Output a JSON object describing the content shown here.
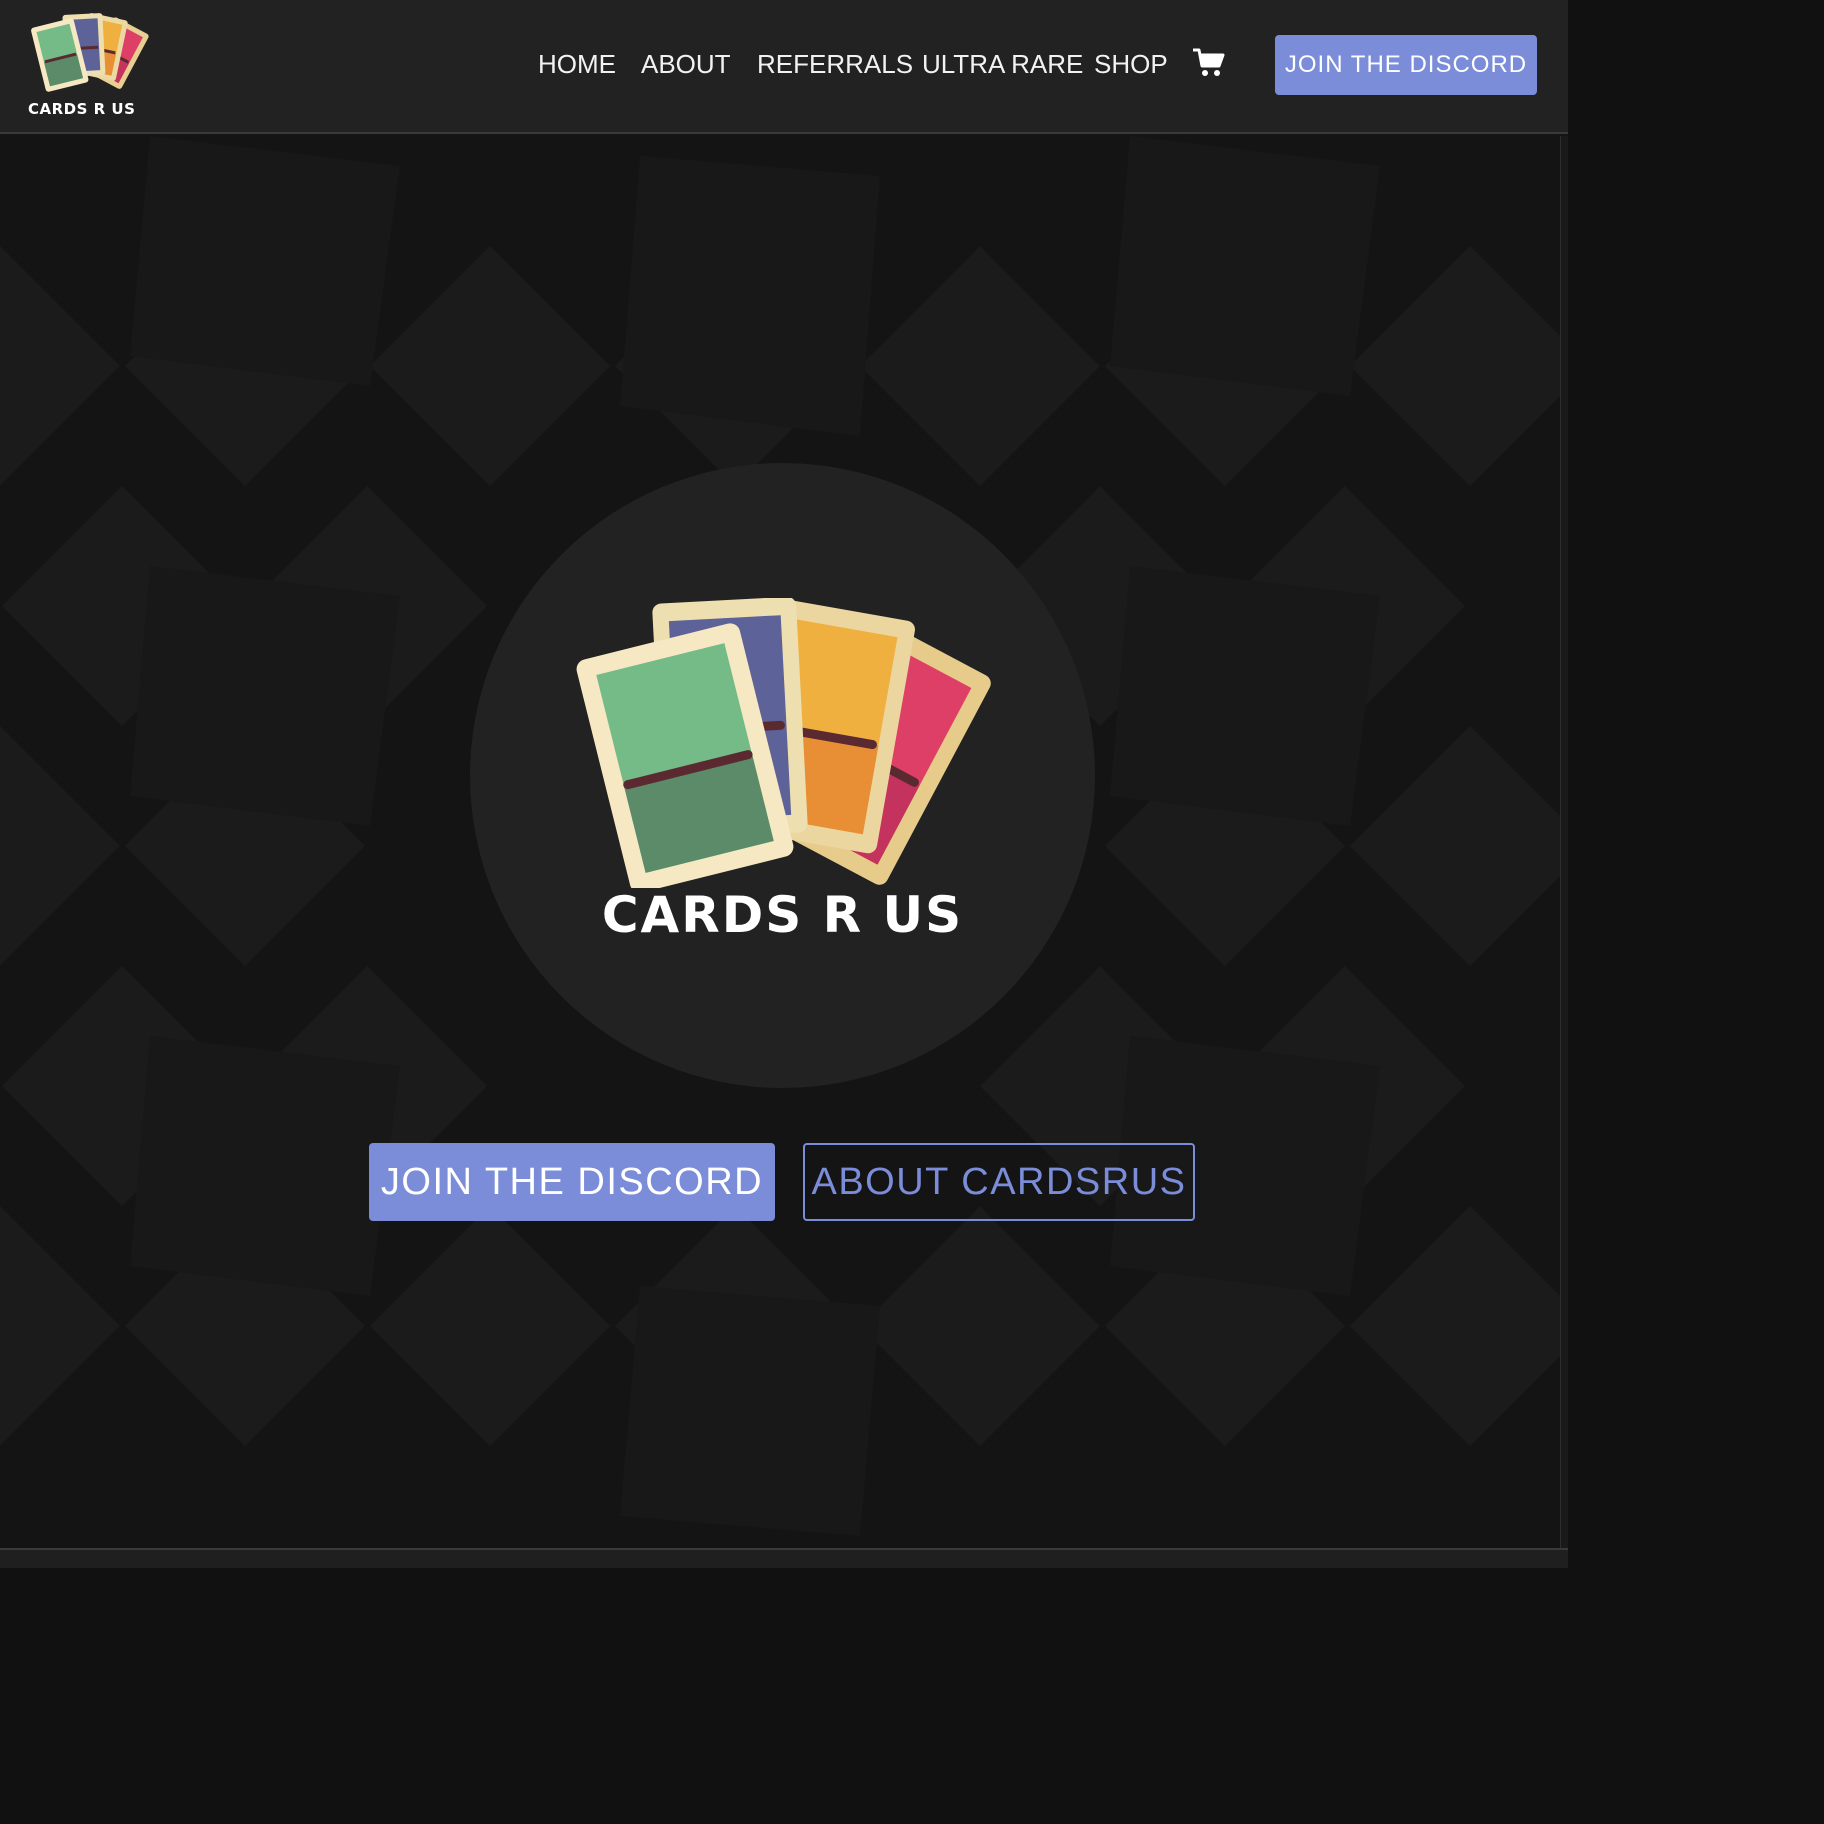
{
  "site": {
    "brand_name": "CARDS R US"
  },
  "header": {
    "nav": [
      {
        "label": "HOME"
      },
      {
        "label": "ABOUT"
      },
      {
        "label": "REFERRALS"
      },
      {
        "label": "ULTRA RARE"
      },
      {
        "label": "SHOP"
      }
    ],
    "cart_icon": "shopping-cart-icon",
    "cta_label": "JOIN THE DISCORD"
  },
  "hero": {
    "brand_name": "CARDS R US",
    "primary_cta": "JOIN THE DISCORD",
    "secondary_cta": "ABOUT CARDSRUS"
  },
  "colors": {
    "accent": "#7b8cd8",
    "header_bg": "#222223",
    "page_bg": "#151516",
    "card_green": "#74bb87",
    "card_purple": "#5d6298",
    "card_orange": "#efb040",
    "card_pink": "#de3f66",
    "card_frame": "#f6e8c3"
  }
}
